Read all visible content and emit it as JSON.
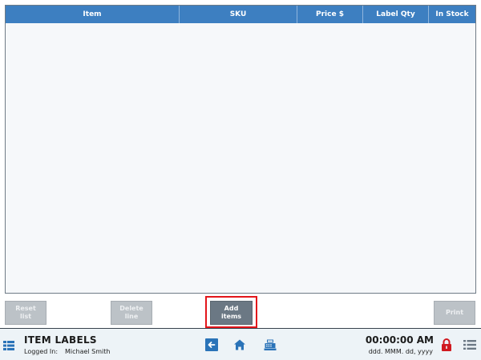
{
  "table": {
    "columns": [
      "Item",
      "SKU",
      "Price $",
      "Label Qty",
      "In Stock"
    ],
    "rows": []
  },
  "actions": {
    "reset_label": "Reset\nlist",
    "delete_label": "Delete\nline",
    "add_label": "Add\nitems",
    "print_label": "Print"
  },
  "status_bar": {
    "title": "ITEM LABELS",
    "logged_in_label": "Logged In:",
    "user_name": "Michael Smith",
    "time": "00:00:00 AM",
    "date": "ddd. MMM. dd, yyyy"
  },
  "icons": {
    "menu": "menu-icon",
    "back": "back-arrow-icon",
    "home": "home-icon",
    "register": "cash-register-icon",
    "lock": "lock-icon",
    "list": "list-icon"
  },
  "colors": {
    "header_blue": "#3d7fc1",
    "icon_blue": "#2a73b8",
    "highlight_red": "#e3151a",
    "lock_red": "#d0191f",
    "button_enabled": "#6b7884",
    "button_disabled": "#bcc2c7"
  }
}
